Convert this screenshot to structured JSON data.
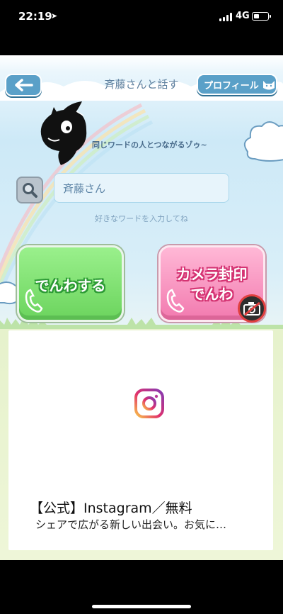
{
  "status_bar": {
    "time": "22:19",
    "network": "4G"
  },
  "nav": {
    "back_icon": "back-arrow-icon",
    "title": "斉藤さんと話す",
    "profile_label": "プロフィール"
  },
  "mascot": {
    "tagline": "同じワードの人とつながるゾゥ~"
  },
  "search": {
    "value": "斉藤さん",
    "hint": "好きなワードを入力してね"
  },
  "buttons": {
    "call": "でんわする",
    "camera_call_line1": "カメラ封印",
    "camera_call_line2": "でんわ"
  },
  "ad": {
    "title": "【公式】Instagram／無料",
    "description": "シェアで広がる新しい出会い。お気に…"
  },
  "colors": {
    "nav_button": "#5aa0c8",
    "call_green": "#7fe06f",
    "call_pink": "#f58dbc"
  }
}
